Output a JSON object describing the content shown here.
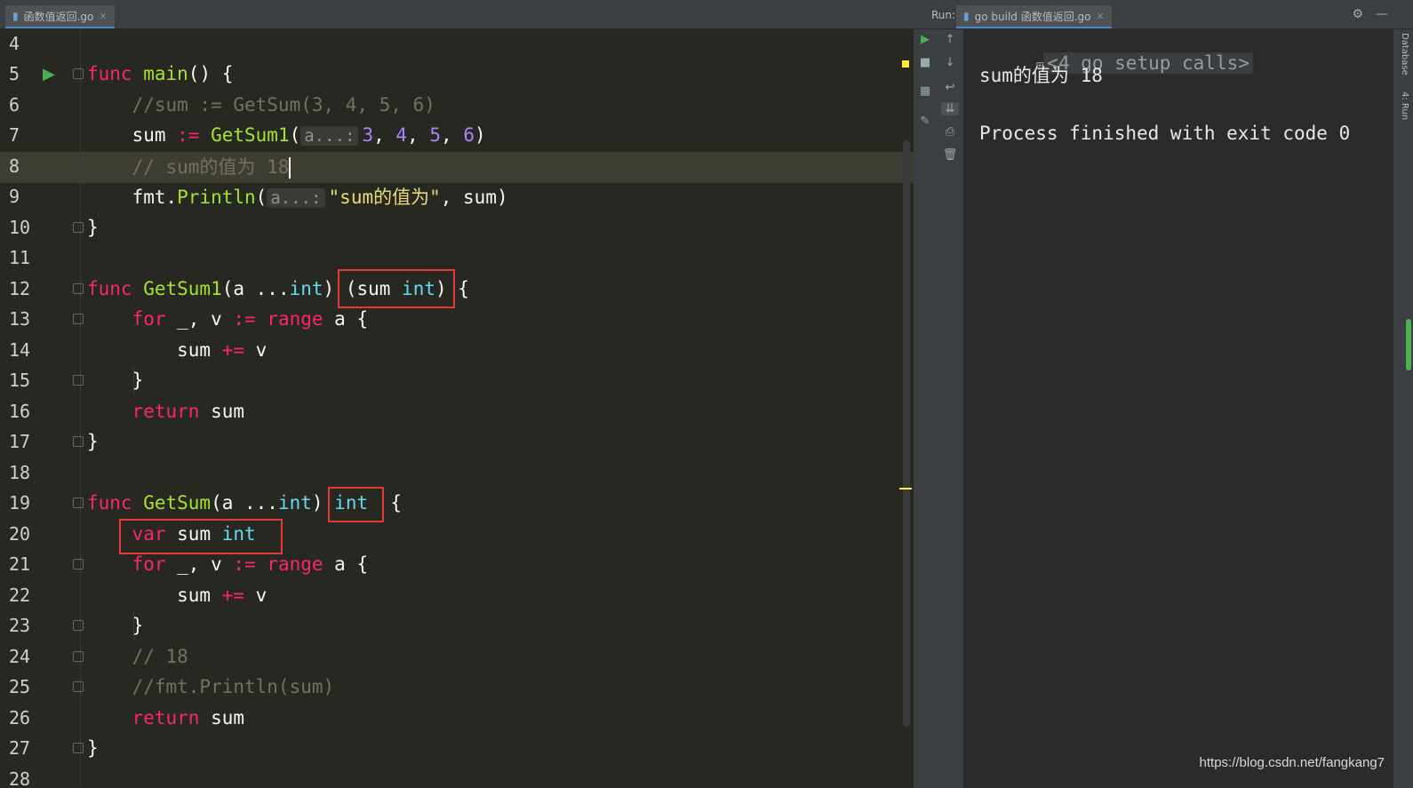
{
  "tabs": {
    "editor_tab": "函数值返回.go",
    "run_label": "Run:",
    "run_tab": "go build 函数值返回.go"
  },
  "editor": {
    "lines": [
      {
        "n": "4",
        "t": []
      },
      {
        "n": "5",
        "t": [
          [
            "kw",
            "func "
          ],
          [
            "fn",
            "main"
          ],
          [
            "pl",
            "() {"
          ]
        ]
      },
      {
        "n": "6",
        "t": [
          [
            "cm",
            "    //sum := GetSum(3, 4, 5, 6)"
          ]
        ]
      },
      {
        "n": "7",
        "t": [
          [
            "pl",
            "    sum "
          ],
          [
            "kw",
            ":= "
          ],
          [
            "fn",
            "GetSum1"
          ],
          [
            "pl",
            "("
          ],
          [
            "hint",
            "a...:"
          ],
          [
            "num",
            "3"
          ],
          [
            "pl",
            ", "
          ],
          [
            "num",
            "4"
          ],
          [
            "pl",
            ", "
          ],
          [
            "num",
            "5"
          ],
          [
            "pl",
            ", "
          ],
          [
            "num",
            "6"
          ],
          [
            "pl",
            ")"
          ]
        ]
      },
      {
        "n": "8",
        "t": [
          [
            "cm",
            "    // sum的值为 18"
          ],
          [
            "cursor",
            ""
          ]
        ]
      },
      {
        "n": "9",
        "t": [
          [
            "pl",
            "    fmt."
          ],
          [
            "fn",
            "Println"
          ],
          [
            "pl",
            "("
          ],
          [
            "hint",
            "a...:"
          ],
          [
            "str",
            "\"sum的值为\""
          ],
          [
            "pl",
            ", sum)"
          ]
        ]
      },
      {
        "n": "10",
        "t": [
          [
            "pl",
            "}"
          ]
        ]
      },
      {
        "n": "11",
        "t": []
      },
      {
        "n": "12",
        "t": [
          [
            "kw",
            "func "
          ],
          [
            "fn",
            "GetSum1"
          ],
          [
            "pl",
            "(a ..."
          ],
          [
            "ty",
            "int"
          ],
          [
            "pl",
            ") (sum "
          ],
          [
            "ty",
            "int"
          ],
          [
            "pl",
            ") {"
          ]
        ]
      },
      {
        "n": "13",
        "t": [
          [
            "kw",
            "    for "
          ],
          [
            "pl",
            "_, v "
          ],
          [
            "kw",
            ":= range "
          ],
          [
            "pl",
            "a {"
          ]
        ]
      },
      {
        "n": "14",
        "t": [
          [
            "pl",
            "        sum "
          ],
          [
            "kw",
            "+= "
          ],
          [
            "pl",
            "v"
          ]
        ]
      },
      {
        "n": "15",
        "t": [
          [
            "pl",
            "    }"
          ]
        ]
      },
      {
        "n": "16",
        "t": [
          [
            "kw",
            "    return "
          ],
          [
            "pl",
            "sum"
          ]
        ]
      },
      {
        "n": "17",
        "t": [
          [
            "pl",
            "}"
          ]
        ]
      },
      {
        "n": "18",
        "t": []
      },
      {
        "n": "19",
        "t": [
          [
            "kw",
            "func "
          ],
          [
            "fn",
            "GetSum"
          ],
          [
            "pl",
            "(a ..."
          ],
          [
            "ty",
            "int"
          ],
          [
            "pl",
            ") "
          ],
          [
            "ty",
            "int"
          ],
          [
            "pl",
            "  {"
          ]
        ]
      },
      {
        "n": "20",
        "t": [
          [
            "kw",
            "    var "
          ],
          [
            "pl",
            "sum "
          ],
          [
            "ty",
            "int"
          ]
        ]
      },
      {
        "n": "21",
        "t": [
          [
            "kw",
            "    for "
          ],
          [
            "pl",
            "_, v "
          ],
          [
            "kw",
            ":= range "
          ],
          [
            "pl",
            "a {"
          ]
        ]
      },
      {
        "n": "22",
        "t": [
          [
            "pl",
            "        sum "
          ],
          [
            "kw",
            "+= "
          ],
          [
            "pl",
            "v"
          ]
        ]
      },
      {
        "n": "23",
        "t": [
          [
            "pl",
            "    }"
          ]
        ]
      },
      {
        "n": "24",
        "t": [
          [
            "cm",
            "    // 18"
          ]
        ]
      },
      {
        "n": "25",
        "t": [
          [
            "cm",
            "    //fmt.Println(sum)"
          ]
        ]
      },
      {
        "n": "26",
        "t": [
          [
            "kw",
            "    return "
          ],
          [
            "pl",
            "sum"
          ]
        ]
      },
      {
        "n": "27",
        "t": [
          [
            "pl",
            "}"
          ]
        ]
      },
      {
        "n": "28",
        "t": []
      }
    ]
  },
  "console": {
    "setup_calls": "<4 go setup calls>",
    "output_line": "sum的值为 18",
    "exit_line": "Process finished with exit code 0"
  },
  "side": {
    "database": "Database",
    "run": "4: Run"
  },
  "watermark": "https://blog.csdn.net/fangkang7",
  "colors": {
    "background": "#272822",
    "keyword": "#f92672",
    "function": "#a6e22e",
    "type": "#66d9ef",
    "number": "#ae81ff",
    "string": "#e6db74",
    "comment": "#75715e",
    "highlight_box": "#e53935"
  }
}
